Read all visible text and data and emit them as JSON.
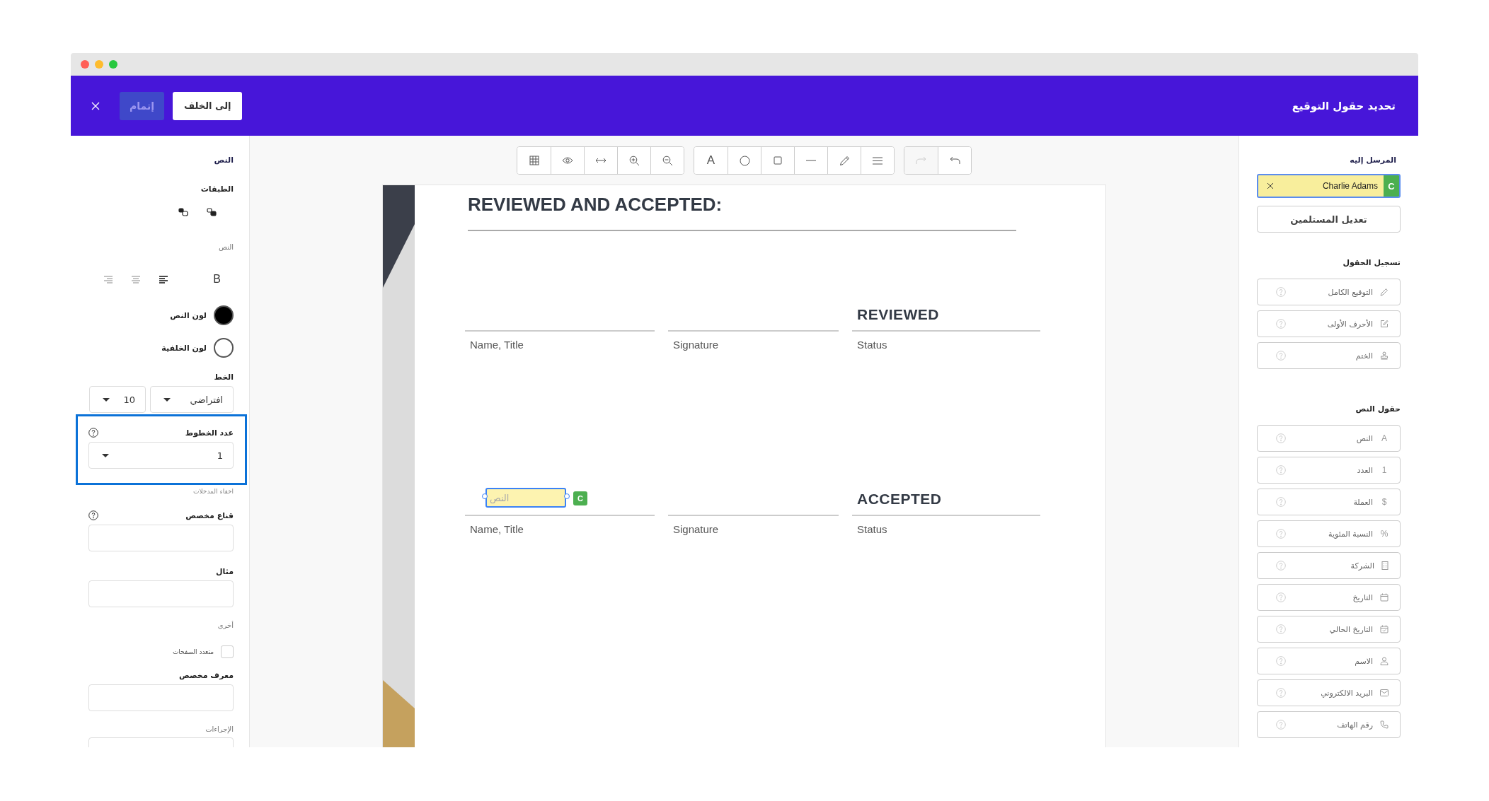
{
  "header": {
    "title": "تحديد حقول التوقيع",
    "back_button": "إلى الخلف",
    "finish_button": {
      "label": "إتمام",
      "disabled": true
    }
  },
  "toolbar": {
    "groups": [
      [
        {
          "kind": "grid"
        },
        {
          "kind": "preview"
        },
        {
          "kind": "fit-width"
        },
        {
          "kind": "zoom-in"
        },
        {
          "kind": "zoom-out"
        }
      ],
      [
        {
          "kind": "text",
          "glyph": "A"
        },
        {
          "kind": "circle"
        },
        {
          "kind": "square"
        },
        {
          "kind": "line"
        },
        {
          "kind": "pencil"
        },
        {
          "kind": "lines"
        }
      ],
      [
        {
          "kind": "redo",
          "disabled": true
        },
        {
          "kind": "undo",
          "disabled": false
        }
      ]
    ]
  },
  "properties": {
    "title": "النص",
    "layers_label": "الطبقات",
    "text_label": "النص",
    "bold_button": "B",
    "alignment": [
      {
        "selected": true
      },
      {
        "selected": false
      },
      {
        "selected": false
      }
    ],
    "text_color": {
      "label": "لون النص",
      "color": "#000000"
    },
    "background_color": {
      "label": "لون الخلفية",
      "color": "#ffffff"
    },
    "font_label": "الخط",
    "font_family": "افتراضي",
    "font_size": "10",
    "line_count": {
      "label": "عدد الخطوط",
      "value": "1",
      "highlighted": true
    },
    "hide_inputs_label": "اخفاء المدخلات",
    "custom_mask": {
      "label": "قناع مخصص"
    },
    "example": {
      "label": "مثال"
    },
    "other_label": "أخرى",
    "multi_page": {
      "label": "متعدد الصفحات",
      "checked": false
    },
    "custom_id": {
      "label": "معرف مخصص"
    },
    "actions_label": "الإجراءات"
  },
  "document": {
    "heading": "REVIEWED AND ACCEPTED:",
    "sections": [
      {
        "status_title": "REVIEWED",
        "name_label": "Name, Title",
        "signature_label": "Signature",
        "status_label": "Status"
      },
      {
        "status_title": "ACCEPTED",
        "name_label": "Name, Title",
        "signature_label": "Signature",
        "status_label": "Status",
        "placed_field": {
          "placeholder": "النص",
          "initial": "C",
          "color": "#4caf50"
        }
      }
    ]
  },
  "recipients": {
    "label": "المرسل إليه",
    "recipient": {
      "name": "Charlie Adams",
      "initial": "C",
      "color": "#4caf50"
    },
    "edit_button": "تعديل المستلمين"
  },
  "signature_fields": {
    "title": "تسجيل الحقول",
    "items": [
      {
        "label": "التوقيع الكامل",
        "kind": "signature"
      },
      {
        "label": "الأحرف الأولى",
        "kind": "initials"
      },
      {
        "label": "الختم",
        "kind": "stamp"
      }
    ]
  },
  "text_fields": {
    "title": "حقول النص",
    "items": [
      {
        "label": "النص",
        "kind": "text",
        "glyph": "A"
      },
      {
        "label": "العدد",
        "kind": "number",
        "glyph": "1"
      },
      {
        "label": "العملة",
        "kind": "currency",
        "glyph": "$"
      },
      {
        "label": "النسبة المئوية",
        "kind": "percent",
        "glyph": "%"
      },
      {
        "label": "الشركة",
        "kind": "company"
      },
      {
        "label": "التاريخ",
        "kind": "date"
      },
      {
        "label": "التاريخ الحالي",
        "kind": "current-date"
      },
      {
        "label": "الاسم",
        "kind": "name"
      },
      {
        "label": "البريد الالكتروني",
        "kind": "email"
      },
      {
        "label": "رقم الهاتف",
        "kind": "phone"
      }
    ]
  }
}
